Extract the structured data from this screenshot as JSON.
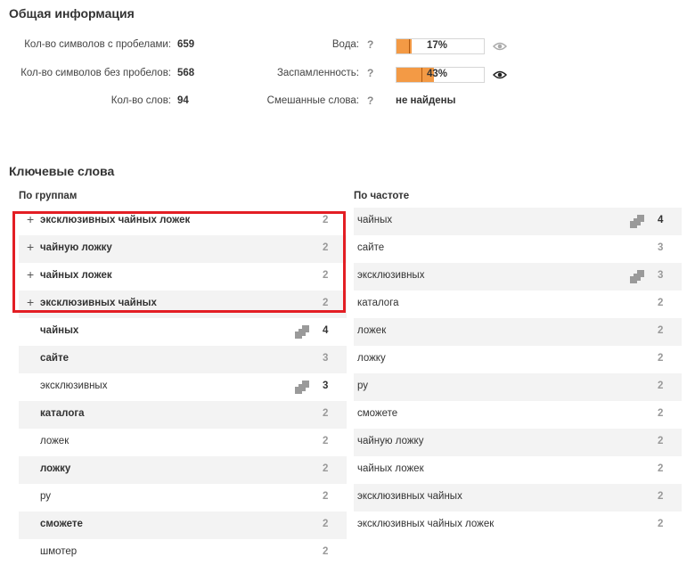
{
  "general": {
    "title": "Общая информация",
    "chars_with_spaces_label": "Кол-во символов с пробелами:",
    "chars_with_spaces_value": "659",
    "chars_no_spaces_label": "Кол-во символов без пробелов:",
    "chars_no_spaces_value": "568",
    "words_label": "Кол-во слов:",
    "words_value": "94",
    "water_label": "Вода:",
    "water_value": "17%",
    "water_percent": 17,
    "spam_label": "Заспамленность:",
    "spam_value": "43%",
    "spam_percent": 43,
    "mixed_label": "Смешанные слова:",
    "mixed_value": "не найдены",
    "help_glyph": "?"
  },
  "keywords": {
    "title": "Ключевые слова",
    "groups_header": "По группам",
    "freq_header": "По частоте",
    "groups": [
      {
        "text": "эксклюзивных чайных ложек",
        "count": "2",
        "plus": "+",
        "bold": true,
        "stack": false,
        "dark": false
      },
      {
        "text": "чайную ложку",
        "count": "2",
        "plus": "+",
        "bold": true,
        "stack": false,
        "dark": false
      },
      {
        "text": "чайных ложек",
        "count": "2",
        "plus": "+",
        "bold": true,
        "stack": false,
        "dark": false
      },
      {
        "text": "эксклюзивных чайных",
        "count": "2",
        "plus": "+",
        "bold": true,
        "stack": false,
        "dark": false
      },
      {
        "text": "чайных",
        "count": "4",
        "plus": "",
        "bold": true,
        "stack": true,
        "dark": true
      },
      {
        "text": "сайте",
        "count": "3",
        "plus": "",
        "bold": true,
        "stack": false,
        "dark": false
      },
      {
        "text": "эксклюзивных",
        "count": "3",
        "plus": "",
        "bold": false,
        "stack": true,
        "dark": true
      },
      {
        "text": "каталога",
        "count": "2",
        "plus": "",
        "bold": true,
        "stack": false,
        "dark": false
      },
      {
        "text": "ложек",
        "count": "2",
        "plus": "",
        "bold": false,
        "stack": false,
        "dark": false
      },
      {
        "text": "ложку",
        "count": "2",
        "plus": "",
        "bold": true,
        "stack": false,
        "dark": false
      },
      {
        "text": "ру",
        "count": "2",
        "plus": "",
        "bold": false,
        "stack": false,
        "dark": false
      },
      {
        "text": "сможете",
        "count": "2",
        "plus": "",
        "bold": true,
        "stack": false,
        "dark": false
      },
      {
        "text": "шмотер",
        "count": "2",
        "plus": "",
        "bold": false,
        "stack": false,
        "dark": false
      }
    ],
    "frequency": [
      {
        "text": "чайных",
        "count": "4",
        "stack": true,
        "dark": true
      },
      {
        "text": "сайте",
        "count": "3",
        "stack": false,
        "dark": false
      },
      {
        "text": "эксклюзивных",
        "count": "3",
        "stack": true,
        "dark": false
      },
      {
        "text": "каталога",
        "count": "2",
        "stack": false,
        "dark": false
      },
      {
        "text": "ложек",
        "count": "2",
        "stack": false,
        "dark": false
      },
      {
        "text": "ложку",
        "count": "2",
        "stack": false,
        "dark": false
      },
      {
        "text": "ру",
        "count": "2",
        "stack": false,
        "dark": false
      },
      {
        "text": "сможете",
        "count": "2",
        "stack": false,
        "dark": false
      },
      {
        "text": "чайную ложку",
        "count": "2",
        "stack": false,
        "dark": false
      },
      {
        "text": "чайных ложек",
        "count": "2",
        "stack": false,
        "dark": false
      },
      {
        "text": "эксклюзивных чайных",
        "count": "2",
        "stack": false,
        "dark": false
      },
      {
        "text": "эксклюзивных чайных ложек",
        "count": "2",
        "stack": false,
        "dark": false
      }
    ]
  },
  "colors": {
    "bar_fill": "#f39a45",
    "highlight_border": "#e31e24",
    "row_alt": "#f3f3f3"
  },
  "icons": [
    "question-icon",
    "eye-icon",
    "plus-icon",
    "stack-icon"
  ]
}
